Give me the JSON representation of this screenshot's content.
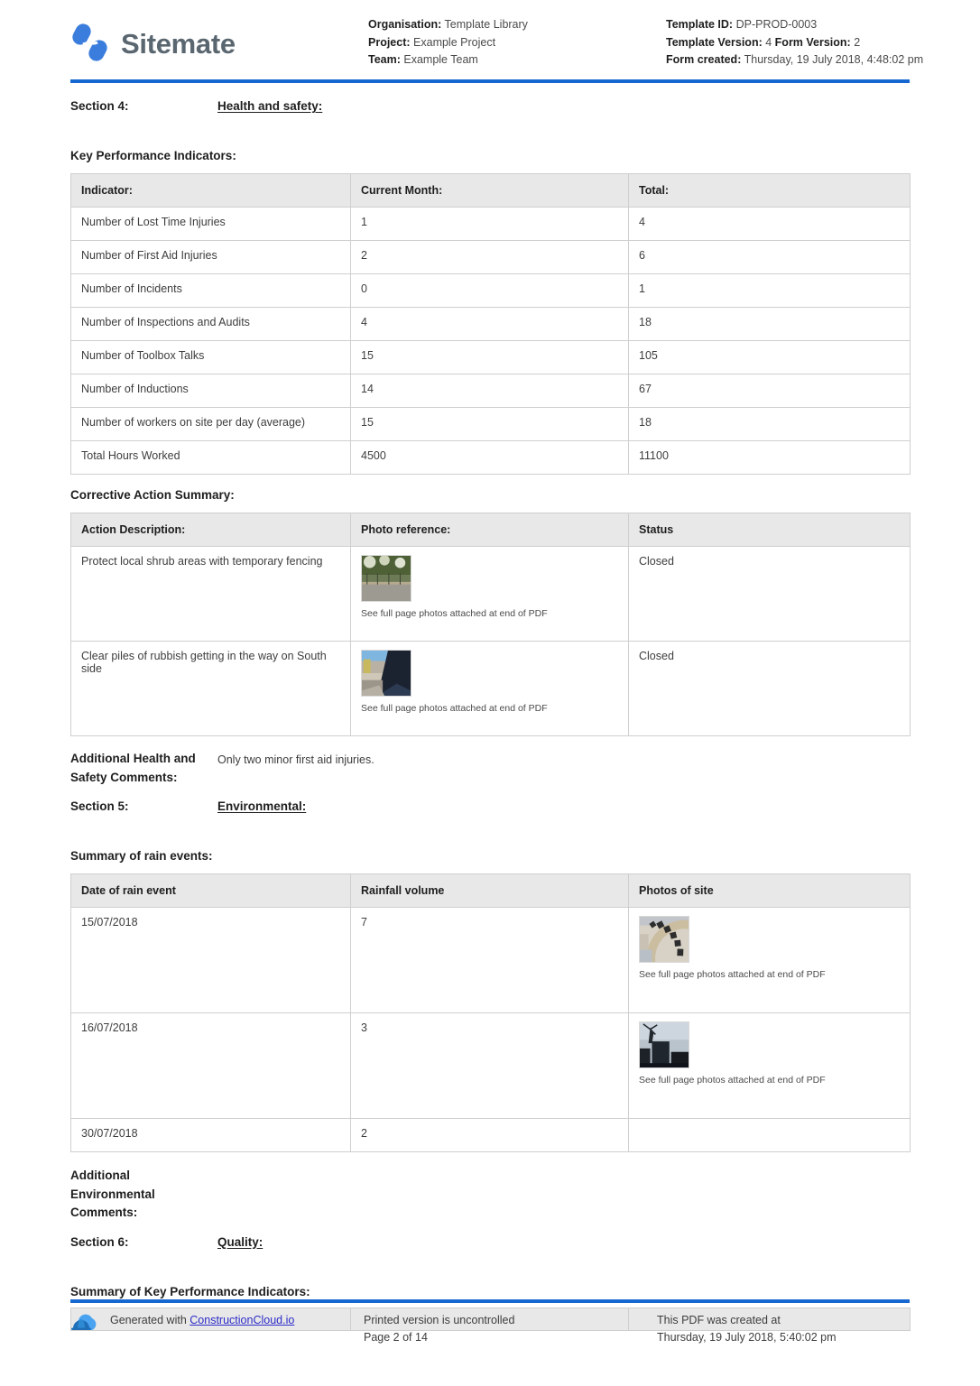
{
  "header": {
    "brand_name": "Sitemate",
    "logo_icon": "sitemate-logo-icon",
    "left_meta": [
      {
        "label": "Organisation:",
        "value": "Template Library"
      },
      {
        "label": "Project:",
        "value": "Example Project"
      },
      {
        "label": "Team:",
        "value": "Example Team"
      }
    ],
    "right_meta": [
      {
        "label": "Template ID:",
        "value": "DP-PROD-0003"
      },
      {
        "label": "Template Version:",
        "value": "4",
        "label2": "Form Version:",
        "value2": "2"
      },
      {
        "label": "Form created:",
        "value": "Thursday, 19 July 2018, 4:48:02 pm"
      }
    ],
    "rule_color": "#1667cf"
  },
  "section4": {
    "label": "Section 4:",
    "title": "Health and safety:",
    "kpi_title": "Key Performance Indicators:",
    "kpi_table": {
      "headers": [
        "Indicator:",
        "Current Month:",
        "Total:"
      ],
      "rows": [
        [
          "Number of Lost Time Injuries",
          "1",
          "4"
        ],
        [
          "Number of First Aid Injuries",
          "2",
          "6"
        ],
        [
          "Number of Incidents",
          "0",
          "1"
        ],
        [
          "Number of Inspections and Audits",
          "4",
          "18"
        ],
        [
          "Number of Toolbox Talks",
          "15",
          "105"
        ],
        [
          "Number of Inductions",
          "14",
          "67"
        ],
        [
          "Number of workers on site per day (average)",
          "15",
          "18"
        ],
        [
          "Total Hours Worked",
          "4500",
          "11100"
        ]
      ]
    },
    "corrective_title": "Corrective Action Summary:",
    "corrective_table": {
      "headers": [
        "Action Description:",
        "Photo reference:",
        "Status"
      ],
      "rows": [
        {
          "description": "Protect local shrub areas with temporary fencing",
          "photo_caption": "See full page photos attached at end of PDF",
          "photo_icon": "photo-thumbnail-fence",
          "status": "Closed"
        },
        {
          "description": "Clear piles of rubbish getting in the way on South side",
          "photo_caption": "See full page photos attached at end of PDF",
          "photo_icon": "photo-thumbnail-rubbish",
          "status": "Closed"
        }
      ]
    },
    "comments_label": "Additional Health and Safety Comments:",
    "comments_value": "Only two minor first aid injuries."
  },
  "section5": {
    "label": "Section 5:",
    "title": "Environmental:",
    "rain_title": "Summary of rain events:",
    "rain_table": {
      "headers": [
        "Date of rain event",
        "Rainfall volume",
        "Photos of site"
      ],
      "rows": [
        {
          "date": "15/07/2018",
          "volume": "7",
          "photo_caption": "See full page photos attached at end of PDF",
          "photo_icon": "photo-thumbnail-structure"
        },
        {
          "date": "16/07/2018",
          "volume": "3",
          "photo_caption": "See full page photos attached at end of PDF",
          "photo_icon": "photo-thumbnail-silhouette"
        },
        {
          "date": "30/07/2018",
          "volume": "2",
          "photo_caption": "",
          "photo_icon": ""
        }
      ]
    },
    "comments_label": "Additional Environmental Comments:",
    "comments_value": ""
  },
  "section6": {
    "label": "Section 6:",
    "title": "Quality:",
    "kpi_summary_title": "Summary of Key Performance Indicators:"
  },
  "footer": {
    "generated_prefix": "Generated with",
    "generated_link": "ConstructionCloud.io",
    "icon": "construction-cloud-icon",
    "printed_line1": "Printed version is uncontrolled",
    "printed_line2": "Page 2 of 14",
    "created_line1": "This PDF was created at",
    "created_line2": "Thursday, 19 July 2018, 5:40:02 pm",
    "rule_color": "#1667cf"
  }
}
